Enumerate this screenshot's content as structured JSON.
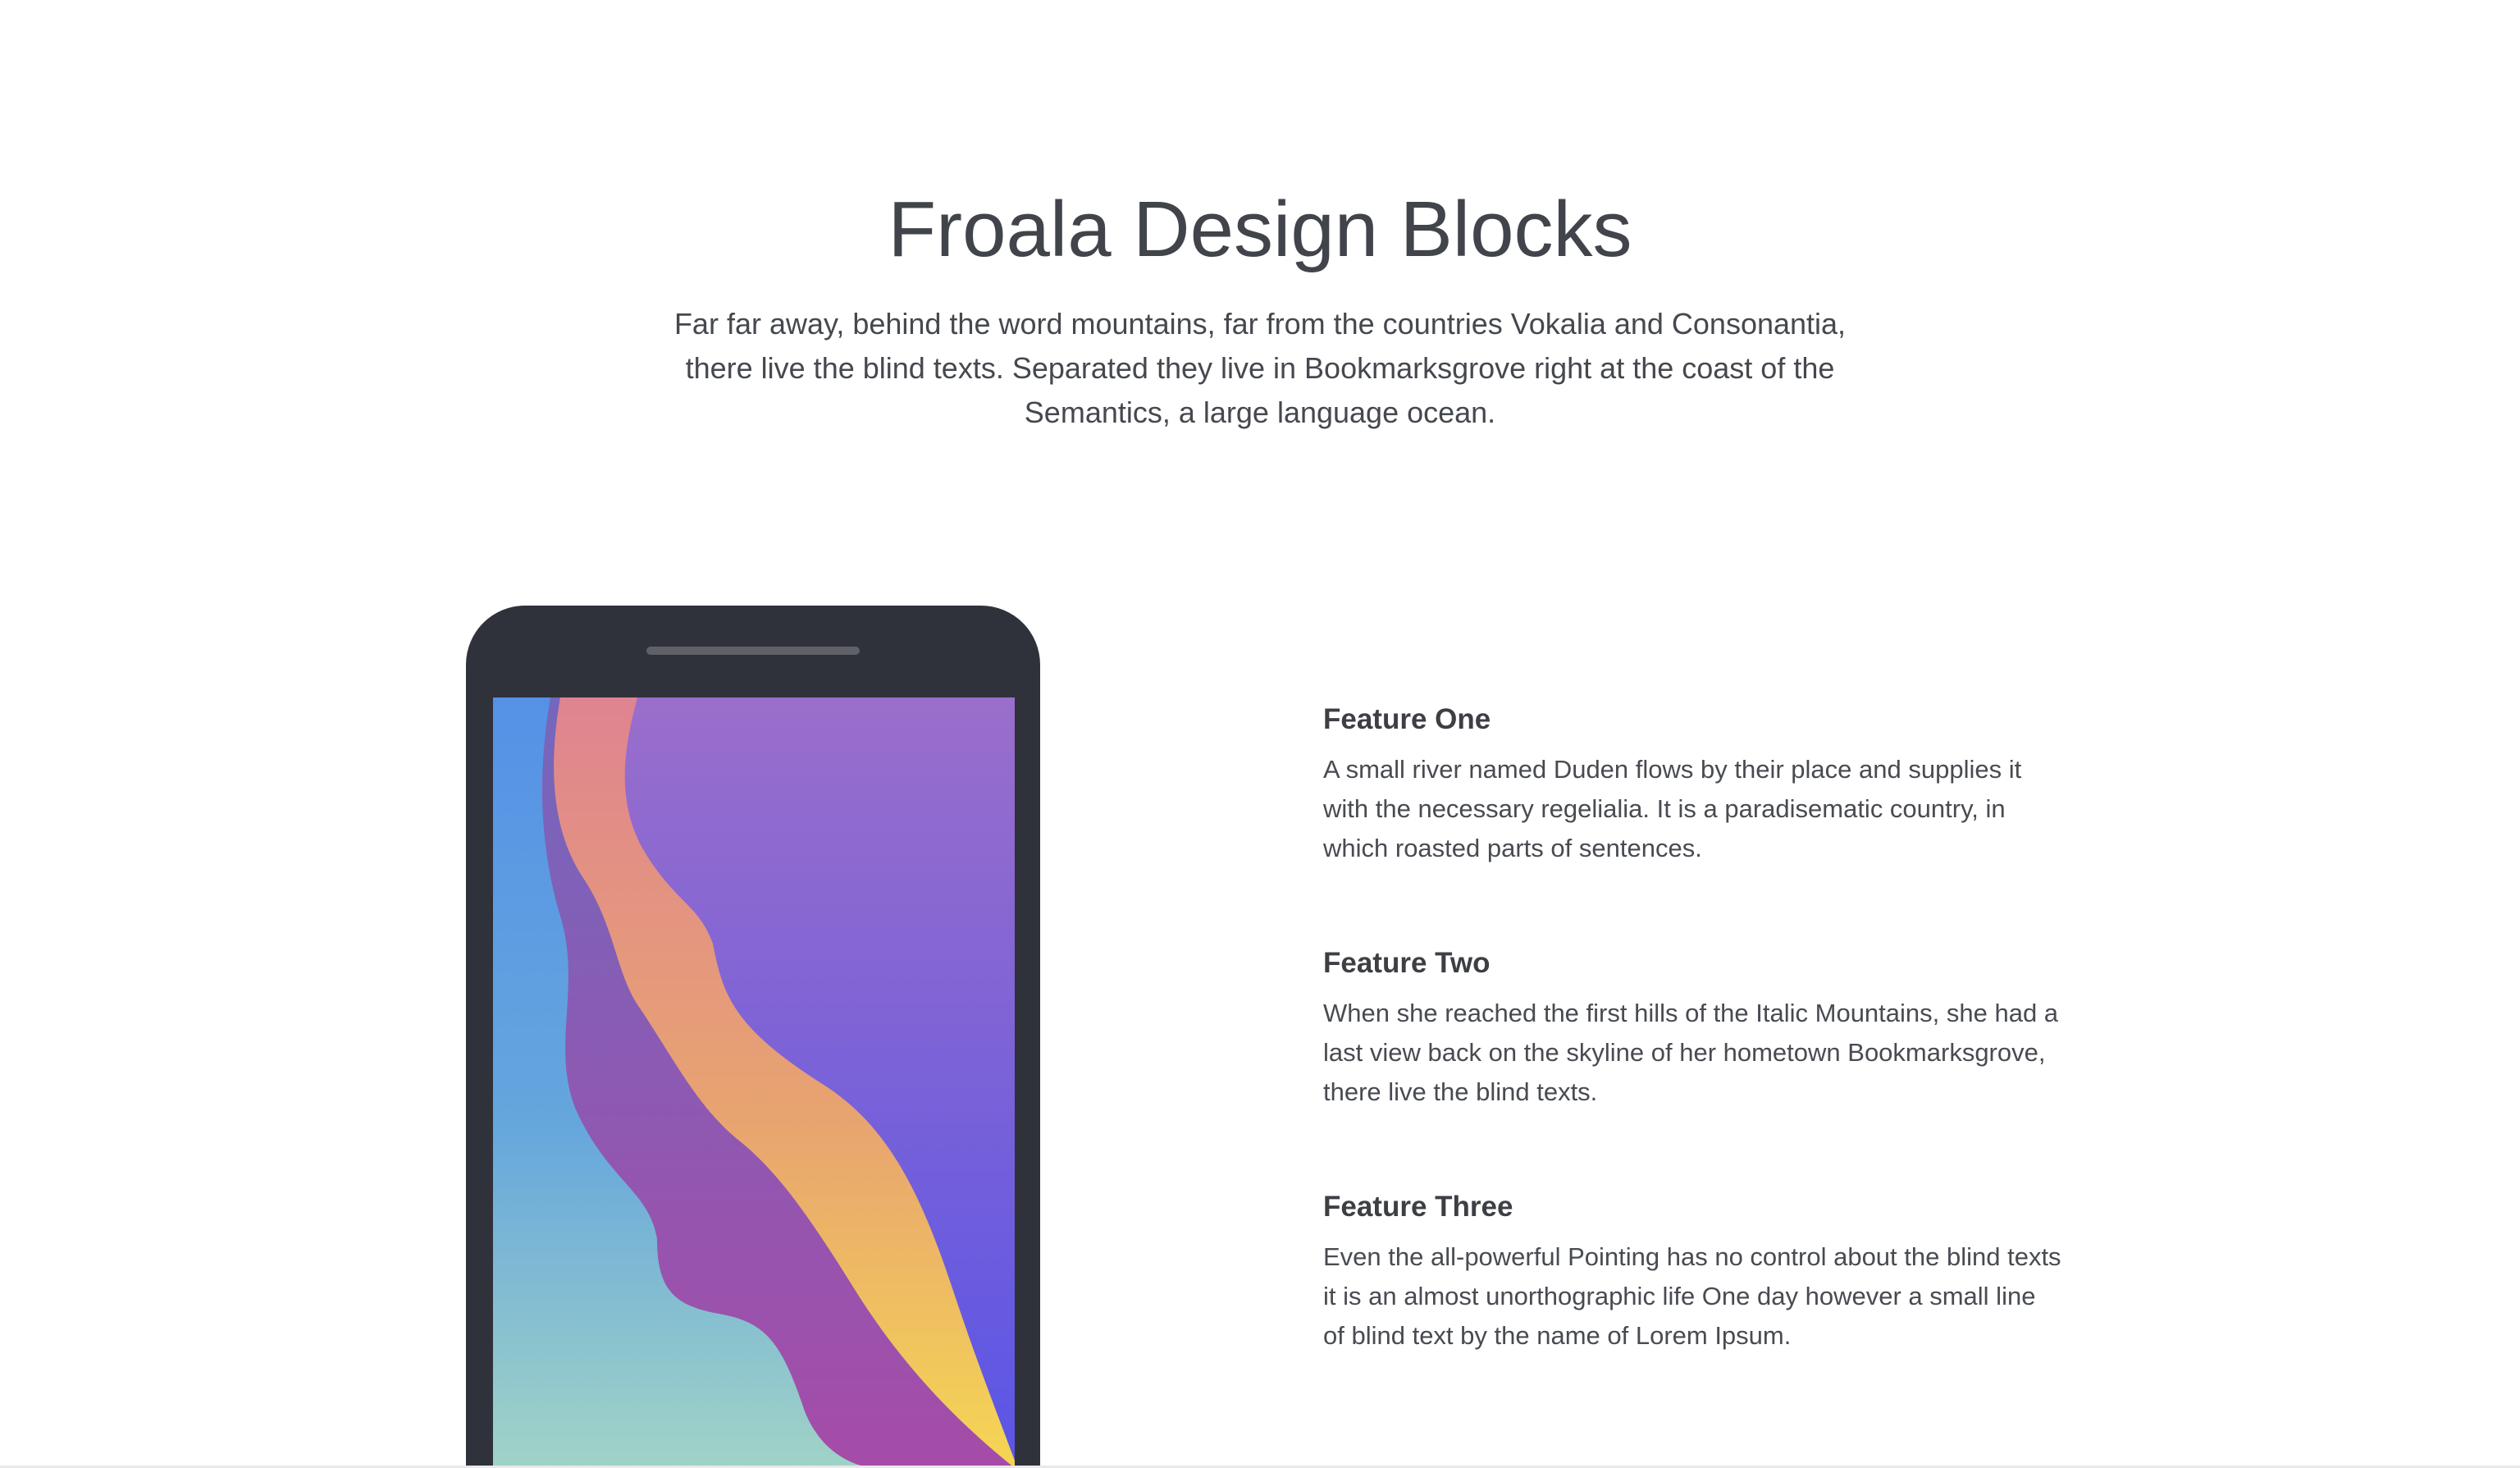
{
  "header": {
    "title": "Froala Design Blocks",
    "subtitle": "Far far away, behind the word mountains, far from the countries Vokalia and Consonantia, there live the blind texts. Separated they live in Bookmarksgrove right at the coast of the Semantics, a large language ocean."
  },
  "features": [
    {
      "title": "Feature One",
      "text": "A small river named Duden flows by their place and supplies it with the necessary regelialia. It is a paradisematic country, in which roasted parts of sentences."
    },
    {
      "title": "Feature Two",
      "text": "When she reached the first hills of the Italic Mountains, she had a last view back on the skyline of her hometown Bookmarksgrove, there live the blind texts."
    },
    {
      "title": "Feature Three",
      "text": "Even the all-powerful Pointing has no control about the blind texts it is an almost unorthographic life One day however a small line of blind text by the name of Lorem Ipsum."
    }
  ],
  "colors": {
    "phone_body": "#30323b",
    "screen_violet": "#9a6ecb",
    "screen_indigo": "#5a55e6",
    "wave_blue": "#5aa0e0",
    "wave_teal": "#9dd4c8",
    "wave_purple": "#9a4fb0",
    "wave_orange": "#e8a070",
    "wave_yellow": "#f4d452"
  },
  "icons": {
    "phone": "phone-illustration"
  }
}
